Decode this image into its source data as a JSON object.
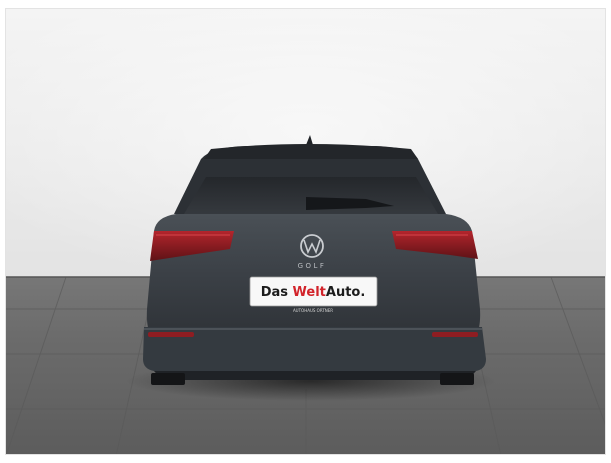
{
  "photo": {
    "subject": "Rear view of a grey Volkswagen Golf estate in a studio",
    "model_badge": "GOLF",
    "plate": {
      "part1": "Das ",
      "part2": "Welt",
      "part3": "Auto.",
      "subline": "AUTOHAUS ORTNER"
    },
    "colors": {
      "car_body": "#3d4247",
      "plate_accent": "#d2232a",
      "floor": "#6b6b6b",
      "wall": "#efefef"
    }
  }
}
